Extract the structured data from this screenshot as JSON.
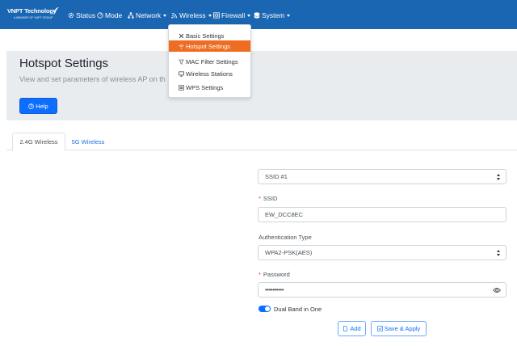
{
  "brand": {
    "name": "VNPT Technology",
    "tagline": "A MEMBER OF VNPT GROUP"
  },
  "nav": {
    "status": "Status",
    "mode": "Mode",
    "network": "Network",
    "wireless": "Wireless",
    "firewall": "Firewall",
    "system": "System"
  },
  "wireless_menu": {
    "items": [
      {
        "label": "Basic Settings",
        "icon": "tools-icon"
      },
      {
        "label": "Hotspot Settings",
        "icon": "wifi-icon",
        "active": true
      },
      {
        "label": "MAC Filter Settings",
        "icon": "filter-icon"
      },
      {
        "label": "Wireless Stations",
        "icon": "monitor-icon"
      },
      {
        "label": "WPS Settings",
        "icon": "list-icon"
      }
    ]
  },
  "header": {
    "title": "Hotspot Settings",
    "subtitle": "View and set parameters of wireless AP on th",
    "help_label": "Help"
  },
  "tabs": [
    {
      "label": "2.4G Wireless",
      "active": true
    },
    {
      "label": "5G Wireless",
      "active": false
    }
  ],
  "form": {
    "ssid_select": "SSID #1",
    "ssid_label": "SSID",
    "ssid_value": "EW_DCC8EC",
    "auth_label": "Authentication Type",
    "auth_value": "WPA2-PSK(AES)",
    "password_label": "Password",
    "password_value": "••••••••••",
    "dual_band_label": "Dual Band in One",
    "dual_band_on": true,
    "add_label": "Add",
    "save_label": "Save & Apply"
  },
  "colors": {
    "navbar": "#1a66b3",
    "active_menu": "#ee6d22",
    "primary": "#0d6efd",
    "required": "#dc3545"
  }
}
